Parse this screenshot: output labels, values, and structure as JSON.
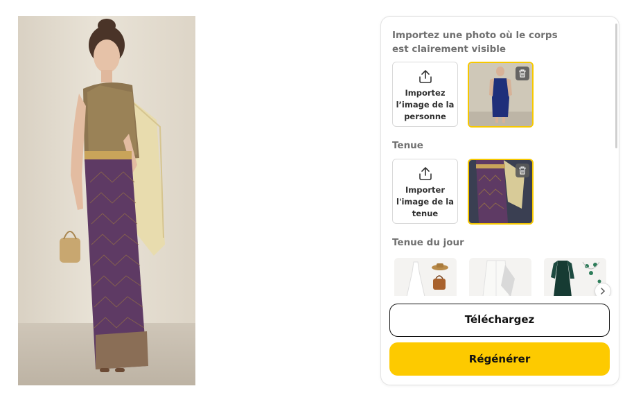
{
  "panel": {
    "person_section_label": "Importez une photo où le corps est clairement visible",
    "person_upload_label": "Importez l’image de la personne",
    "outfit_section_label": "Tenue",
    "outfit_upload_label": "Importer l'image de la tenue",
    "outfit_of_day_label": "Tenue du jour",
    "download_button": "Téléchargez",
    "regenerate_button": "Régénérer"
  },
  "icons": {
    "upload": "upload-icon",
    "trash": "trash-icon",
    "next": "chevron-right-icon"
  },
  "colors": {
    "accent_yellow": "#fdca00",
    "thumb_border": "#f6c800",
    "label_gray": "#707070"
  }
}
